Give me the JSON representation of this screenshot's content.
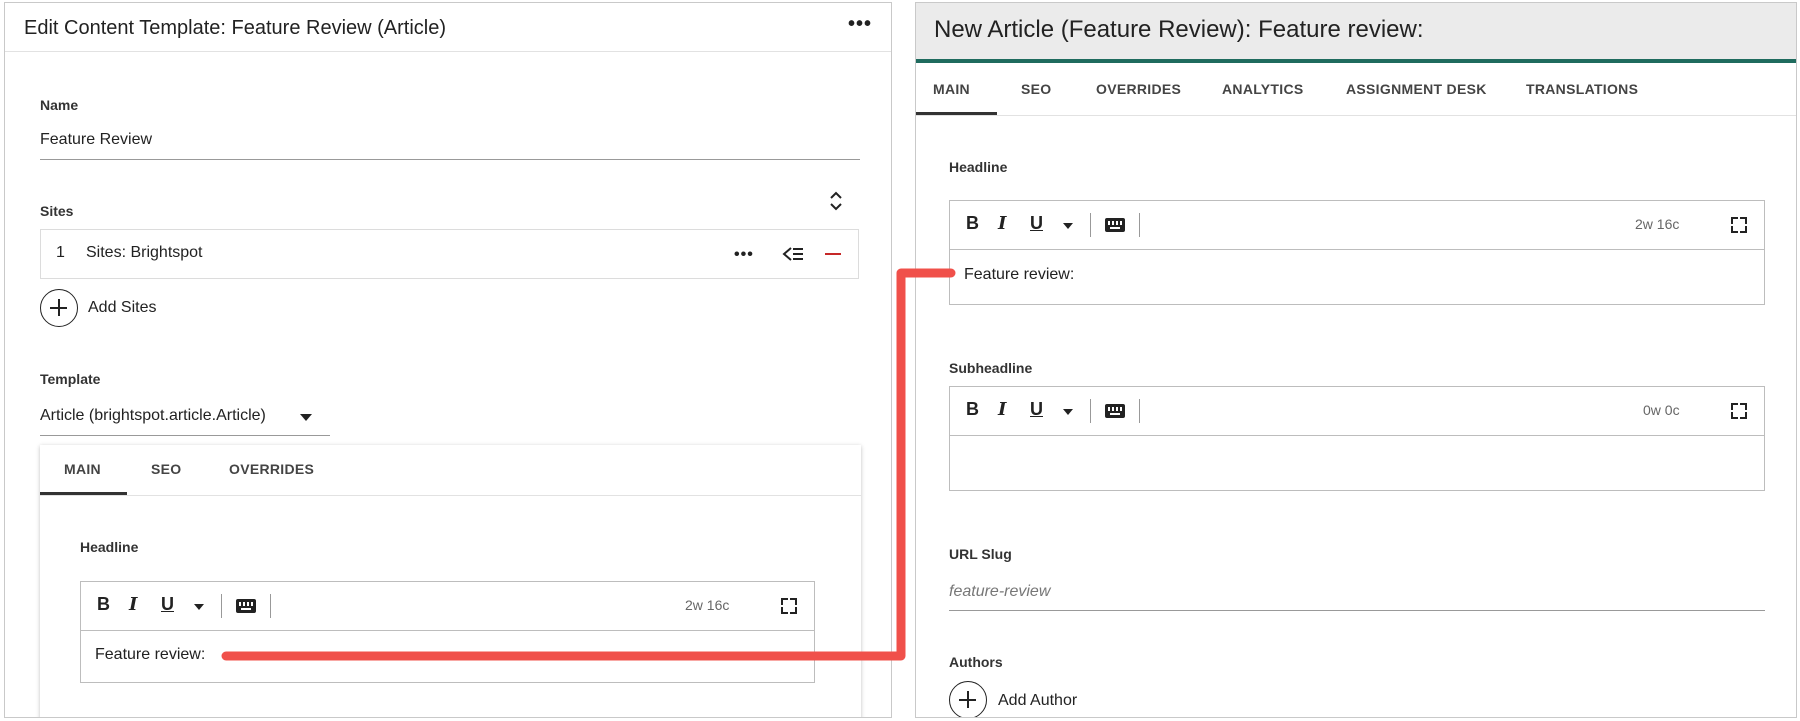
{
  "left": {
    "title": "Edit Content Template: Feature Review (Article)",
    "name_label": "Name",
    "name_value": "Feature Review",
    "sites_label": "Sites",
    "sites_item_index": "1",
    "sites_item_label": "Sites: Brightspot",
    "add_sites_label": "Add Sites",
    "template_label": "Template",
    "template_value": "Article (brightspot.article.Article)",
    "tabs": [
      "MAIN",
      "SEO",
      "OVERRIDES"
    ],
    "active_tab": "MAIN",
    "headline_label": "Headline",
    "headline_count": "2w 16c",
    "headline_value": "Feature review:"
  },
  "right": {
    "title": "New Article (Feature Review): Feature review:",
    "tabs": [
      "MAIN",
      "SEO",
      "OVERRIDES",
      "ANALYTICS",
      "ASSIGNMENT DESK",
      "TRANSLATIONS"
    ],
    "active_tab": "MAIN",
    "headline_label": "Headline",
    "headline_count": "2w 16c",
    "headline_value": "Feature review:",
    "subheadline_label": "Subheadline",
    "subheadline_count": "0w 0c",
    "subheadline_value": "",
    "url_slug_label": "URL Slug",
    "url_slug_placeholder": "feature-review",
    "authors_label": "Authors",
    "add_author_label": "Add Author"
  },
  "toolbar": {
    "bold": "B",
    "italic": "I",
    "underline": "U"
  },
  "colors": {
    "accent": "#1f6b5e",
    "remove": "#c62828",
    "connector": "#f0504a"
  },
  "icons": [
    "more-icon",
    "sort-icon",
    "reorder-icon",
    "remove-icon",
    "add-icon",
    "dropdown-caret-icon",
    "keyboard-icon",
    "fullscreen-icon"
  ]
}
